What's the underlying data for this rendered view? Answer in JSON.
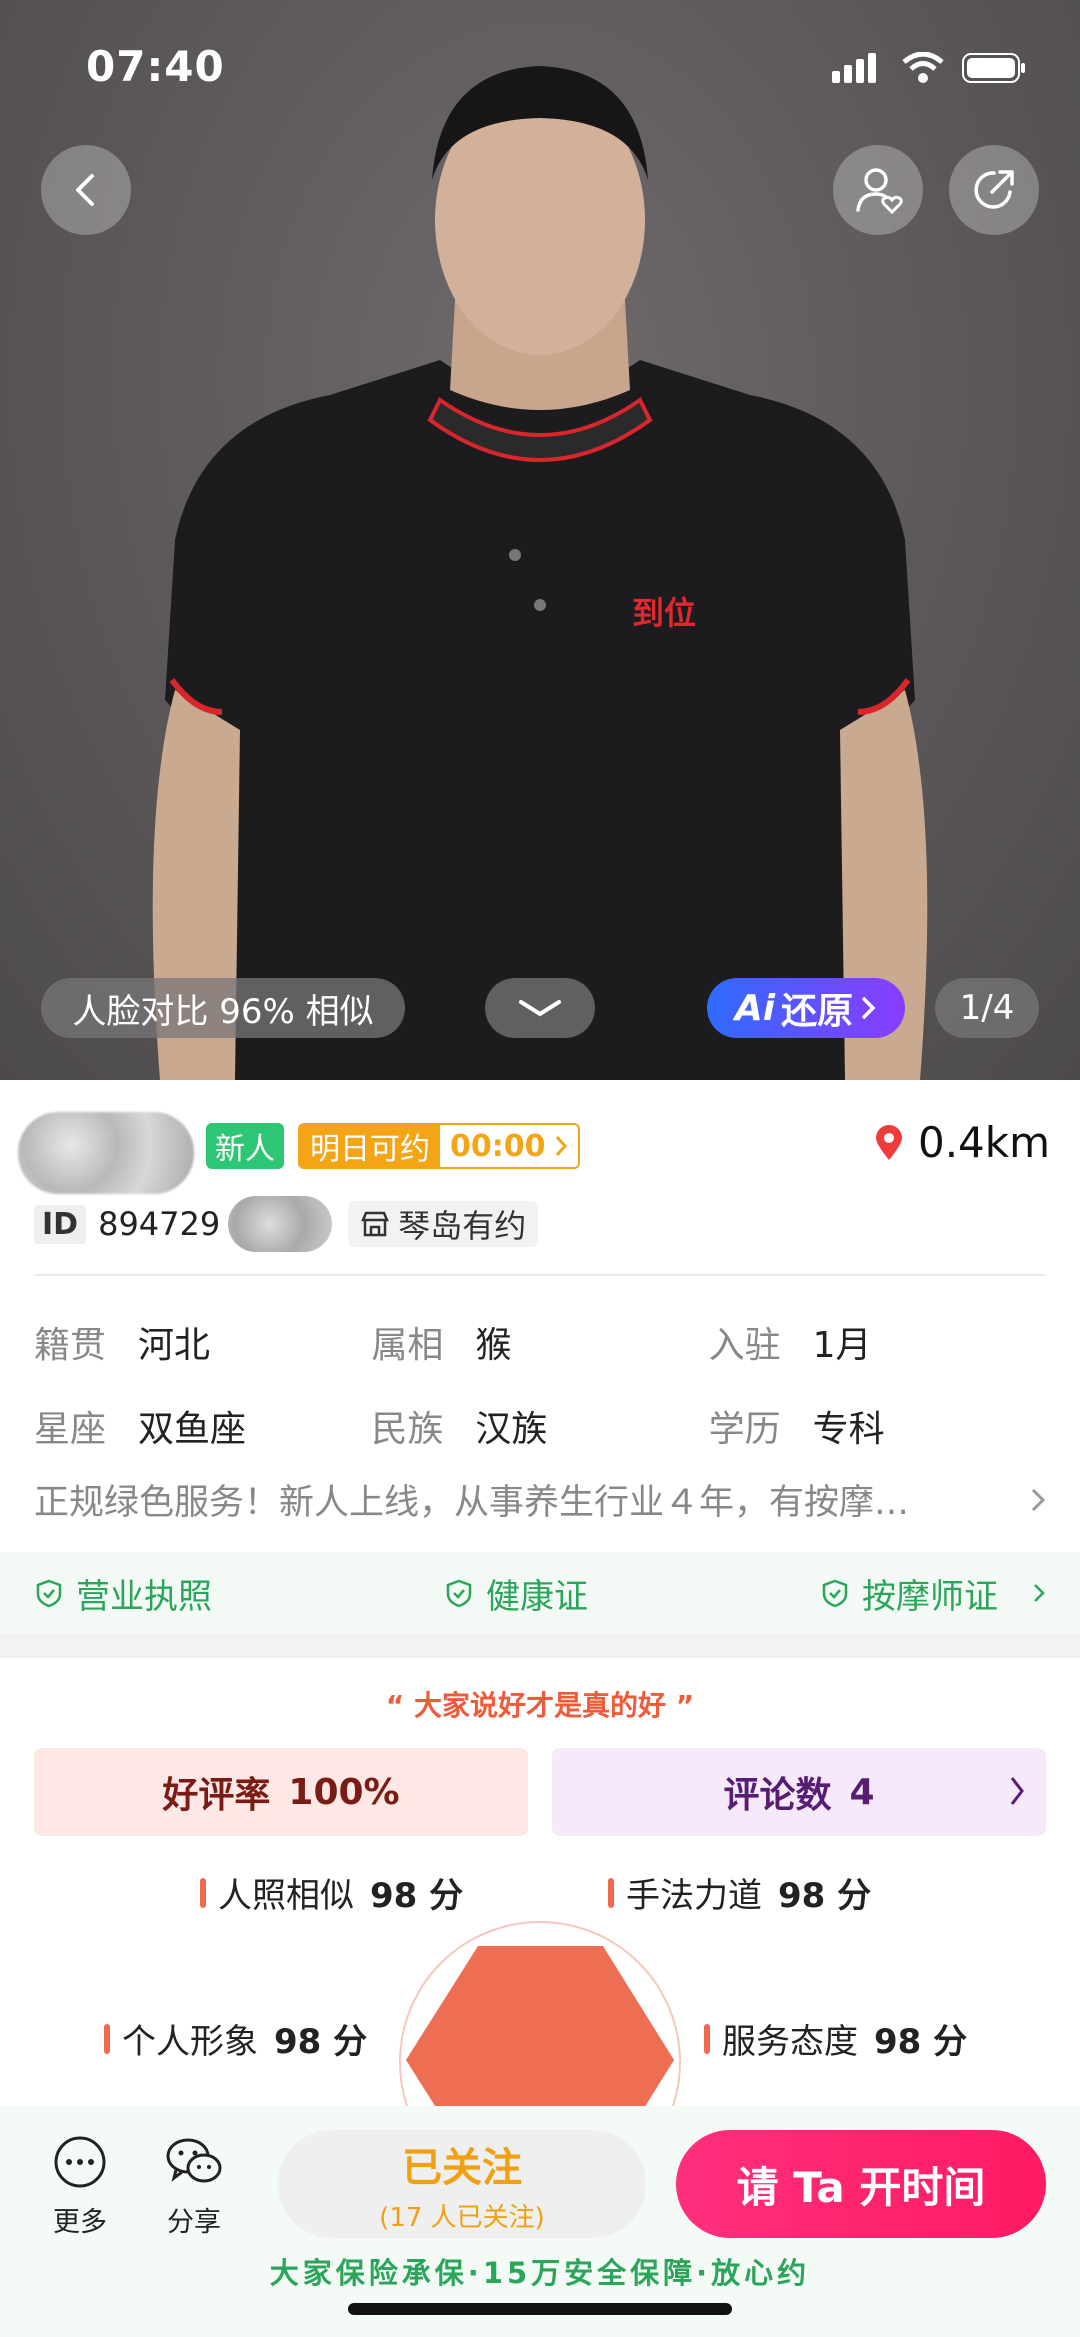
{
  "status_bar": {
    "time": "07:40"
  },
  "hero": {
    "face_match": "人脸对比 96% 相似",
    "ai_restore": "还原",
    "ai_prefix": "Ai",
    "counter": "1/4",
    "shirt_logo": "到位"
  },
  "profile": {
    "tag_new": "新人",
    "tag_tomorrow": "明日可约",
    "tag_time": "00:00",
    "distance": "0.4km",
    "id_label": "ID",
    "id_value": "894729",
    "store": "琴岛有约"
  },
  "info": {
    "rows": [
      [
        {
          "k": "籍贯",
          "v": "河北"
        },
        {
          "k": "属相",
          "v": "猴"
        },
        {
          "k": "入驻",
          "v": "1月"
        }
      ],
      [
        {
          "k": "星座",
          "v": "双鱼座"
        },
        {
          "k": "民族",
          "v": "汉族"
        },
        {
          "k": "学历",
          "v": "专科"
        }
      ]
    ],
    "intro": "正规绿色服务！新人上线，从事养生行业４年，有按摩…"
  },
  "certs": [
    "营业执照",
    "健康证",
    "按摩师证"
  ],
  "reviews": {
    "slogan": "“ 大家说好才是真的好 ”",
    "good_rate_label": "好评率",
    "good_rate": "100%",
    "comments_label": "评论数",
    "comments": "4",
    "scores": [
      {
        "label": "人照相似",
        "value": "98 分"
      },
      {
        "label": "手法力道",
        "value": "98 分"
      },
      {
        "label": "个人形象",
        "value": "98 分"
      },
      {
        "label": "服务态度",
        "value": "98 分"
      }
    ]
  },
  "bottom": {
    "more": "更多",
    "share": "分享",
    "follow_title": "已关注",
    "follow_sub": "(17 人已关注)",
    "book": "请 Ta 开时间",
    "guarantee": "大家保险承保·15万安全保障·放心约"
  },
  "colors": {
    "accent_pink": "#ff1a63",
    "green": "#2aa55a",
    "orange": "#f3a516",
    "radar": "#ee6e54"
  }
}
